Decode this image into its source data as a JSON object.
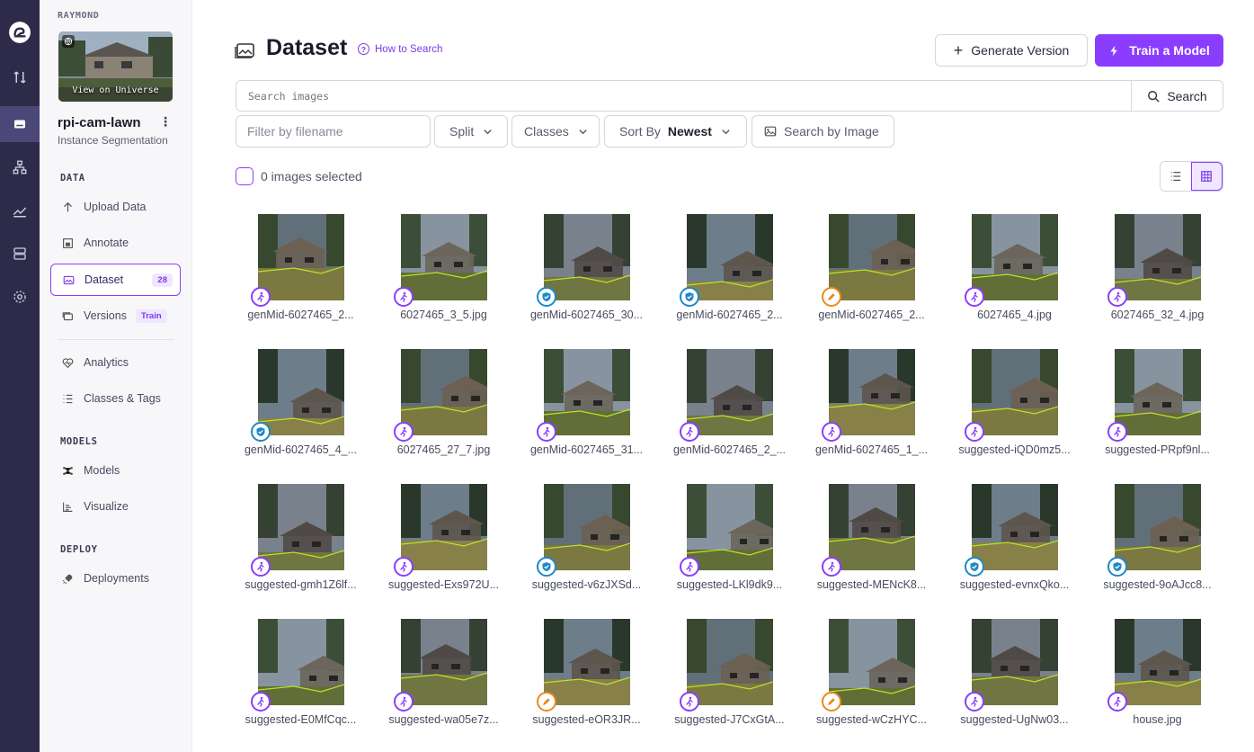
{
  "sidebar": {
    "workspace": "RAYMOND",
    "thumb_label": "View on Universe",
    "project_name": "rpi-cam-lawn",
    "project_type": "Instance Segmentation",
    "sections": {
      "data": "DATA",
      "models": "MODELS",
      "deploy": "DEPLOY"
    },
    "items": {
      "upload": "Upload Data",
      "annotate": "Annotate",
      "dataset": "Dataset",
      "dataset_badge": "28",
      "versions": "Versions",
      "versions_badge": "Train",
      "analytics": "Analytics",
      "classes": "Classes & Tags",
      "models": "Models",
      "visualize": "Visualize",
      "deployments": "Deployments"
    }
  },
  "header": {
    "title": "Dataset",
    "how_to_search": "How to Search",
    "generate_version": "Generate Version",
    "train_model": "Train a Model"
  },
  "search": {
    "placeholder": "Search images",
    "button": "Search"
  },
  "filters": {
    "filename_placeholder": "Filter by filename",
    "split": "Split",
    "classes": "Classes",
    "sort_label": "Sort By",
    "sort_value": "Newest",
    "search_by_image": "Search by Image"
  },
  "selection": {
    "count_text": "0 images selected"
  },
  "colors": {
    "accent": "#8b3dff",
    "approved": "#1e88c8",
    "annotating": "#e88a1a",
    "rail": "#2e2b4a"
  },
  "images": [
    {
      "name": "genMid-6027465_2...",
      "status": "unassigned"
    },
    {
      "name": "6027465_3_5.jpg",
      "status": "unassigned"
    },
    {
      "name": "genMid-6027465_30...",
      "status": "approved"
    },
    {
      "name": "genMid-6027465_2...",
      "status": "approved"
    },
    {
      "name": "genMid-6027465_2...",
      "status": "annotating"
    },
    {
      "name": "6027465_4.jpg",
      "status": "unassigned"
    },
    {
      "name": "6027465_32_4.jpg",
      "status": "unassigned"
    },
    {
      "name": "genMid-6027465_4_...",
      "status": "approved"
    },
    {
      "name": "6027465_27_7.jpg",
      "status": "unassigned"
    },
    {
      "name": "genMid-6027465_31...",
      "status": "unassigned"
    },
    {
      "name": "genMid-6027465_2_...",
      "status": "unassigned"
    },
    {
      "name": "genMid-6027465_1_...",
      "status": "unassigned"
    },
    {
      "name": "suggested-iQD0mz5...",
      "status": "unassigned"
    },
    {
      "name": "suggested-PRpf9nl...",
      "status": "unassigned"
    },
    {
      "name": "suggested-gmh1Z6lf...",
      "status": "unassigned"
    },
    {
      "name": "suggested-Exs972U...",
      "status": "unassigned"
    },
    {
      "name": "suggested-v6zJXSd...",
      "status": "approved"
    },
    {
      "name": "suggested-LKl9dk9...",
      "status": "unassigned"
    },
    {
      "name": "suggested-MENcK8...",
      "status": "unassigned"
    },
    {
      "name": "suggested-evnxQko...",
      "status": "approved"
    },
    {
      "name": "suggested-9oAJcc8...",
      "status": "approved"
    },
    {
      "name": "suggested-E0MfCqc...",
      "status": "unassigned"
    },
    {
      "name": "suggested-wa05e7z...",
      "status": "unassigned"
    },
    {
      "name": "suggested-eOR3JR...",
      "status": "annotating"
    },
    {
      "name": "suggested-J7CxGtA...",
      "status": "unassigned"
    },
    {
      "name": "suggested-wCzHYC...",
      "status": "annotating"
    },
    {
      "name": "suggested-UgNw03...",
      "status": "unassigned"
    },
    {
      "name": "house.jpg",
      "status": "unassigned"
    }
  ]
}
